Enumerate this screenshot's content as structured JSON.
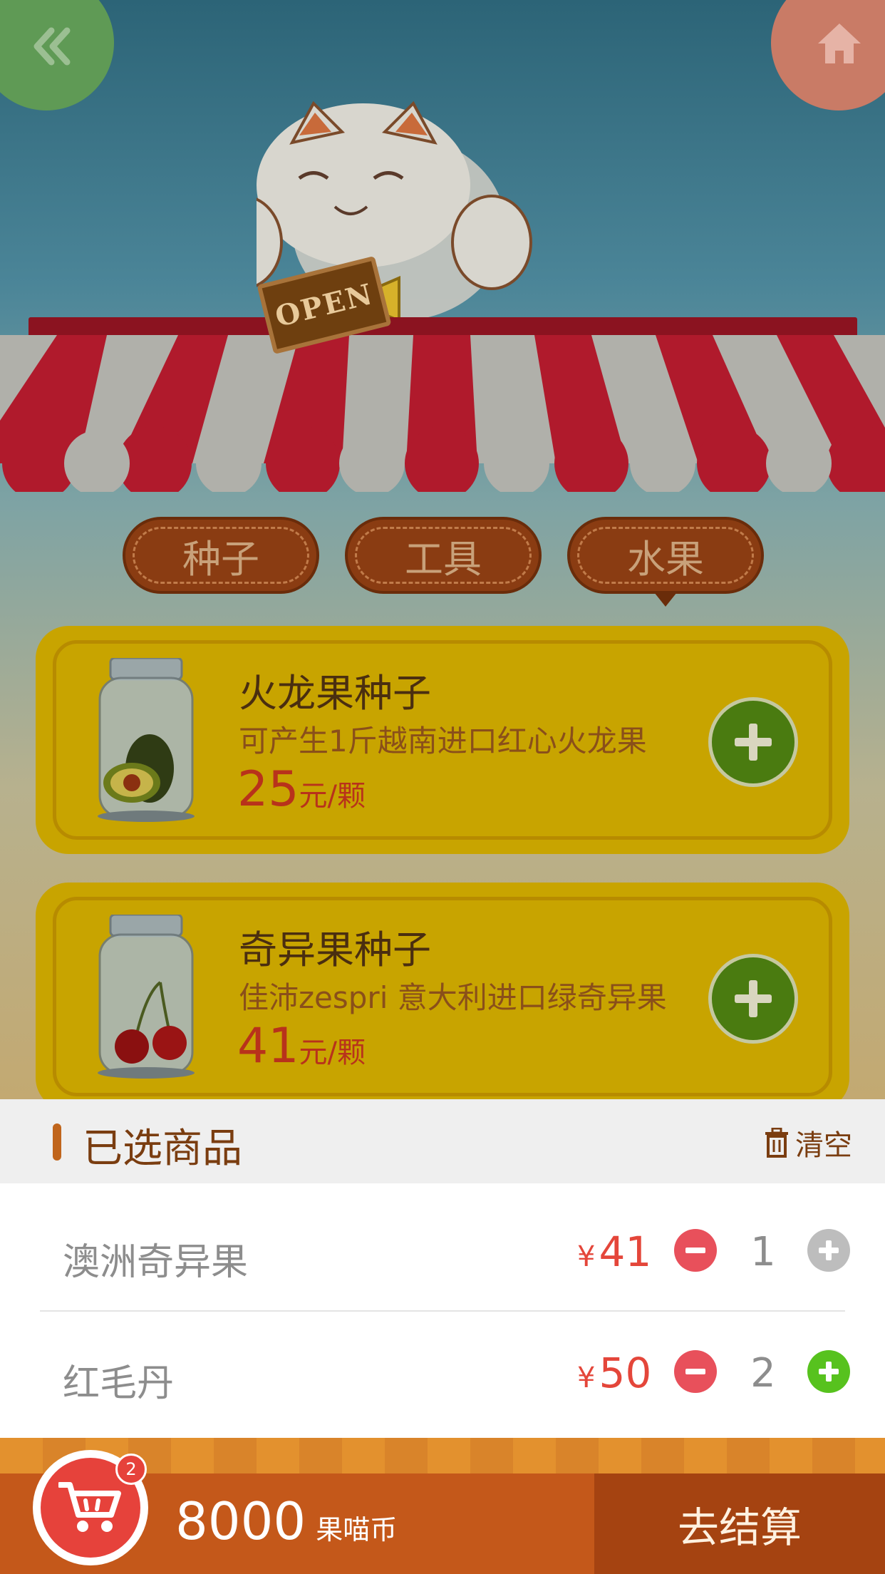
{
  "nav": {
    "back_icon": "double-chevron-left-icon",
    "home_icon": "home-icon"
  },
  "shop_sign": "OPEN",
  "tabs": [
    {
      "label": "种子",
      "active": false
    },
    {
      "label": "工具",
      "active": false
    },
    {
      "label": "水果",
      "active": true
    }
  ],
  "products": [
    {
      "title": "火龙果种子",
      "desc": "可产生1斤越南进口红心火龙果",
      "price": "25",
      "unit": "元/颗",
      "image": "avocado-jar-icon"
    },
    {
      "title": "奇异果种子",
      "desc": "佳沛zespri 意大利进口绿奇异果",
      "price": "41",
      "unit": "元/颗",
      "image": "cherry-jar-icon"
    }
  ],
  "selected_panel": {
    "title": "已选商品",
    "clear_label": "清空",
    "items": [
      {
        "name": "澳洲奇异果",
        "currency": "¥",
        "price": "41",
        "qty": "1",
        "plus_enabled": false
      },
      {
        "name": "红毛丹",
        "currency": "¥",
        "price": "50",
        "qty": "2",
        "plus_enabled": true
      }
    ]
  },
  "bottom_bar": {
    "cart_badge": "2",
    "balance": "8000",
    "currency_label": "果喵币",
    "checkout_label": "去结算"
  },
  "colors": {
    "accent_red": "#e4463a",
    "checkout_bg": "#a54311",
    "bar_bg": "#c4581a",
    "plus_green": "#57c21e",
    "minus_red": "#e8505b"
  }
}
